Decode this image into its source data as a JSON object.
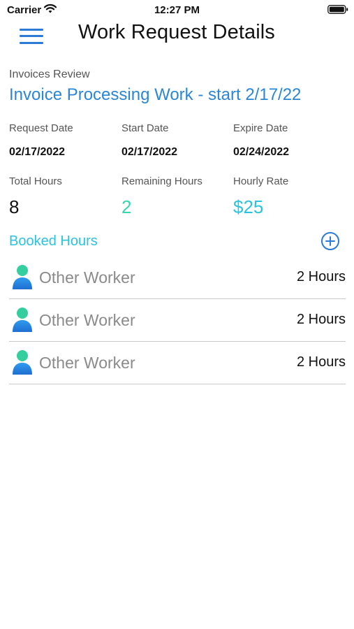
{
  "status_bar": {
    "carrier": "Carrier",
    "time": "12:27 PM"
  },
  "nav": {
    "title": "Work Request Details"
  },
  "request": {
    "category": "Invoices Review",
    "title": "Invoice Processing Work - start 2/17/22"
  },
  "dates": {
    "request_label": "Request Date",
    "request_value": "02/17/2022",
    "start_label": "Start Date",
    "start_value": "02/17/2022",
    "expire_label": "Expire Date",
    "expire_value": "02/24/2022"
  },
  "hours": {
    "total_label": "Total Hours",
    "total_value": "8",
    "remaining_label": "Remaining Hours",
    "remaining_value": "2",
    "rate_label": "Hourly Rate",
    "rate_value": "$25"
  },
  "booked": {
    "label": "Booked Hours",
    "items": [
      {
        "name": "Other Worker",
        "hours": "2 Hours"
      },
      {
        "name": "Other Worker",
        "hours": "2 Hours"
      },
      {
        "name": "Other Worker",
        "hours": "2 Hours"
      }
    ]
  },
  "colors": {
    "accent_blue": "#2b86d6",
    "teal": "#2bc4dc",
    "green": "#37d6b0"
  },
  "icons": [
    "wifi-icon",
    "battery-icon",
    "menu-icon",
    "plus-circle-icon",
    "person-icon"
  ]
}
